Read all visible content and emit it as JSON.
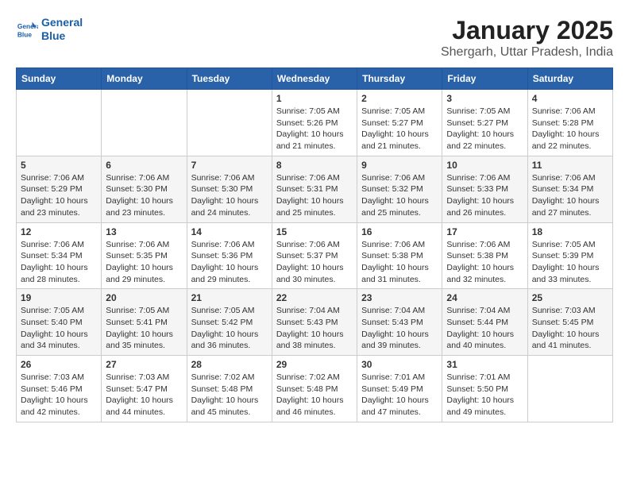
{
  "header": {
    "logo_line1": "General",
    "logo_line2": "Blue",
    "title": "January 2025",
    "subtitle": "Shergarh, Uttar Pradesh, India"
  },
  "days_of_week": [
    "Sunday",
    "Monday",
    "Tuesday",
    "Wednesday",
    "Thursday",
    "Friday",
    "Saturday"
  ],
  "weeks": [
    [
      {
        "num": "",
        "info": ""
      },
      {
        "num": "",
        "info": ""
      },
      {
        "num": "",
        "info": ""
      },
      {
        "num": "1",
        "info": "Sunrise: 7:05 AM\nSunset: 5:26 PM\nDaylight: 10 hours\nand 21 minutes."
      },
      {
        "num": "2",
        "info": "Sunrise: 7:05 AM\nSunset: 5:27 PM\nDaylight: 10 hours\nand 21 minutes."
      },
      {
        "num": "3",
        "info": "Sunrise: 7:05 AM\nSunset: 5:27 PM\nDaylight: 10 hours\nand 22 minutes."
      },
      {
        "num": "4",
        "info": "Sunrise: 7:06 AM\nSunset: 5:28 PM\nDaylight: 10 hours\nand 22 minutes."
      }
    ],
    [
      {
        "num": "5",
        "info": "Sunrise: 7:06 AM\nSunset: 5:29 PM\nDaylight: 10 hours\nand 23 minutes."
      },
      {
        "num": "6",
        "info": "Sunrise: 7:06 AM\nSunset: 5:30 PM\nDaylight: 10 hours\nand 23 minutes."
      },
      {
        "num": "7",
        "info": "Sunrise: 7:06 AM\nSunset: 5:30 PM\nDaylight: 10 hours\nand 24 minutes."
      },
      {
        "num": "8",
        "info": "Sunrise: 7:06 AM\nSunset: 5:31 PM\nDaylight: 10 hours\nand 25 minutes."
      },
      {
        "num": "9",
        "info": "Sunrise: 7:06 AM\nSunset: 5:32 PM\nDaylight: 10 hours\nand 25 minutes."
      },
      {
        "num": "10",
        "info": "Sunrise: 7:06 AM\nSunset: 5:33 PM\nDaylight: 10 hours\nand 26 minutes."
      },
      {
        "num": "11",
        "info": "Sunrise: 7:06 AM\nSunset: 5:34 PM\nDaylight: 10 hours\nand 27 minutes."
      }
    ],
    [
      {
        "num": "12",
        "info": "Sunrise: 7:06 AM\nSunset: 5:34 PM\nDaylight: 10 hours\nand 28 minutes."
      },
      {
        "num": "13",
        "info": "Sunrise: 7:06 AM\nSunset: 5:35 PM\nDaylight: 10 hours\nand 29 minutes."
      },
      {
        "num": "14",
        "info": "Sunrise: 7:06 AM\nSunset: 5:36 PM\nDaylight: 10 hours\nand 29 minutes."
      },
      {
        "num": "15",
        "info": "Sunrise: 7:06 AM\nSunset: 5:37 PM\nDaylight: 10 hours\nand 30 minutes."
      },
      {
        "num": "16",
        "info": "Sunrise: 7:06 AM\nSunset: 5:38 PM\nDaylight: 10 hours\nand 31 minutes."
      },
      {
        "num": "17",
        "info": "Sunrise: 7:06 AM\nSunset: 5:38 PM\nDaylight: 10 hours\nand 32 minutes."
      },
      {
        "num": "18",
        "info": "Sunrise: 7:05 AM\nSunset: 5:39 PM\nDaylight: 10 hours\nand 33 minutes."
      }
    ],
    [
      {
        "num": "19",
        "info": "Sunrise: 7:05 AM\nSunset: 5:40 PM\nDaylight: 10 hours\nand 34 minutes."
      },
      {
        "num": "20",
        "info": "Sunrise: 7:05 AM\nSunset: 5:41 PM\nDaylight: 10 hours\nand 35 minutes."
      },
      {
        "num": "21",
        "info": "Sunrise: 7:05 AM\nSunset: 5:42 PM\nDaylight: 10 hours\nand 36 minutes."
      },
      {
        "num": "22",
        "info": "Sunrise: 7:04 AM\nSunset: 5:43 PM\nDaylight: 10 hours\nand 38 minutes."
      },
      {
        "num": "23",
        "info": "Sunrise: 7:04 AM\nSunset: 5:43 PM\nDaylight: 10 hours\nand 39 minutes."
      },
      {
        "num": "24",
        "info": "Sunrise: 7:04 AM\nSunset: 5:44 PM\nDaylight: 10 hours\nand 40 minutes."
      },
      {
        "num": "25",
        "info": "Sunrise: 7:03 AM\nSunset: 5:45 PM\nDaylight: 10 hours\nand 41 minutes."
      }
    ],
    [
      {
        "num": "26",
        "info": "Sunrise: 7:03 AM\nSunset: 5:46 PM\nDaylight: 10 hours\nand 42 minutes."
      },
      {
        "num": "27",
        "info": "Sunrise: 7:03 AM\nSunset: 5:47 PM\nDaylight: 10 hours\nand 44 minutes."
      },
      {
        "num": "28",
        "info": "Sunrise: 7:02 AM\nSunset: 5:48 PM\nDaylight: 10 hours\nand 45 minutes."
      },
      {
        "num": "29",
        "info": "Sunrise: 7:02 AM\nSunset: 5:48 PM\nDaylight: 10 hours\nand 46 minutes."
      },
      {
        "num": "30",
        "info": "Sunrise: 7:01 AM\nSunset: 5:49 PM\nDaylight: 10 hours\nand 47 minutes."
      },
      {
        "num": "31",
        "info": "Sunrise: 7:01 AM\nSunset: 5:50 PM\nDaylight: 10 hours\nand 49 minutes."
      },
      {
        "num": "",
        "info": ""
      }
    ]
  ]
}
